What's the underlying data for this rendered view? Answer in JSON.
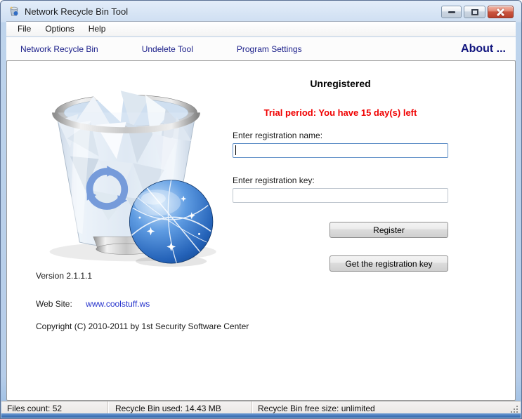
{
  "window": {
    "title": "Network Recycle Bin Tool"
  },
  "menu": {
    "items": [
      "File",
      "Options",
      "Help"
    ]
  },
  "toolbar": {
    "items": [
      "Network Recycle Bin",
      "Undelete Tool",
      "Program Settings"
    ],
    "about_label": "About ..."
  },
  "registration": {
    "status_heading": "Unregistered",
    "trial_message": "Trial period: You have 15 day(s) left",
    "name_label": "Enter registration name:",
    "name_value": "",
    "key_label": "Enter registration key:",
    "key_value": "",
    "register_button": "Register",
    "get_key_button": "Get the registration key"
  },
  "about": {
    "version": "Version 2.1.1.1",
    "website_label": "Web Site:",
    "website_link": "www.coolstuff.ws",
    "copyright": "Copyright (C) 2010-2011 by 1st Security Software Center"
  },
  "statusbar": {
    "files_count": "Files count: 52",
    "bin_used": "Recycle Bin used: 14.43 MB",
    "bin_free": "Recycle Bin free size: unlimited"
  },
  "colors": {
    "nav_link_navy": "#1b1f8a",
    "about_navy": "#10147e",
    "trial_red": "#f00000",
    "web_link_blue": "#2633cc",
    "frame_blue": "#b6cde9",
    "frame_bottom_blue": "#2e61a8",
    "close_button_red": "#cc5741",
    "recycle_arrow_blue": "#4a7ace",
    "globe_blue": "#2462b8"
  },
  "icons": {
    "app": "recycle-bin-app-icon",
    "minimize": "minimize-icon",
    "maximize": "maximize-icon",
    "close": "close-icon",
    "resize": "resize-grip"
  }
}
